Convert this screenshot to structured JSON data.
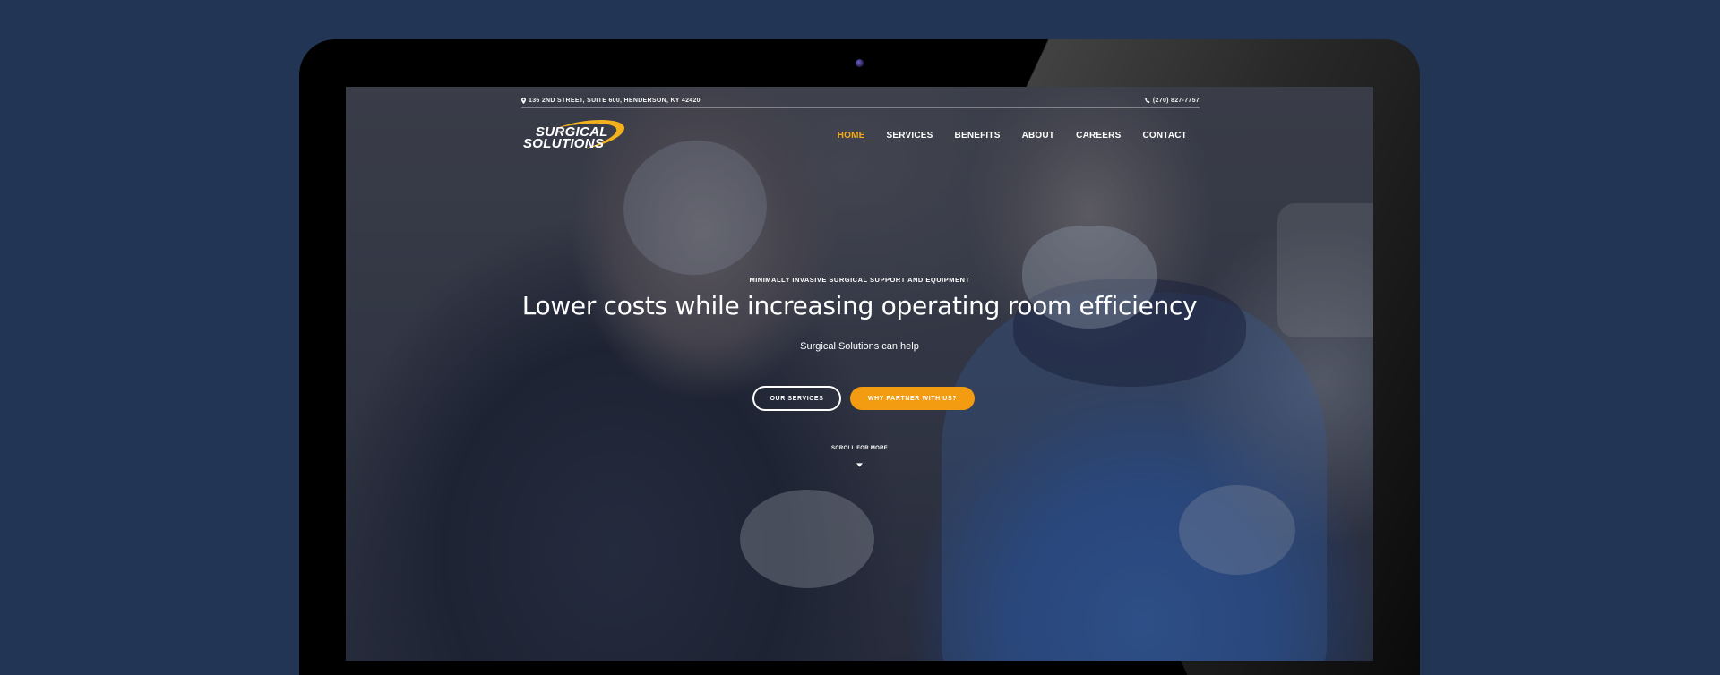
{
  "site": {
    "address": "136 2ND STREET, SUITE 600, HENDERSON, KY 42420",
    "phone": "(270) 827-7757",
    "logo": {
      "line1": "SURGICAL",
      "line2": "SOLUTIONS",
      "swoosh_color": "#f3b21d"
    }
  },
  "nav": {
    "items": [
      {
        "label": "HOME",
        "active": true
      },
      {
        "label": "SERVICES",
        "active": false
      },
      {
        "label": "BENEFITS",
        "active": false
      },
      {
        "label": "ABOUT",
        "active": false
      },
      {
        "label": "CAREERS",
        "active": false
      },
      {
        "label": "CONTACT",
        "active": false
      }
    ]
  },
  "hero": {
    "eyebrow": "MINIMALLY INVASIVE SURGICAL SUPPORT AND EQUIPMENT",
    "headline": "Lower costs while increasing operating room efficiency",
    "subline": "Surgical Solutions can help",
    "primary_button": "OUR SERVICES",
    "secondary_button": "WHY PARTNER WITH US?",
    "scroll_label": "SCROLL FOR MORE"
  },
  "colors": {
    "background": "#223555",
    "accent": "#f39c12",
    "nav_active": "#f3a81d",
    "text": "#ffffff"
  },
  "icons": [
    "map-pin-icon",
    "phone-icon",
    "chevron-down-icon",
    "webcam-icon"
  ]
}
